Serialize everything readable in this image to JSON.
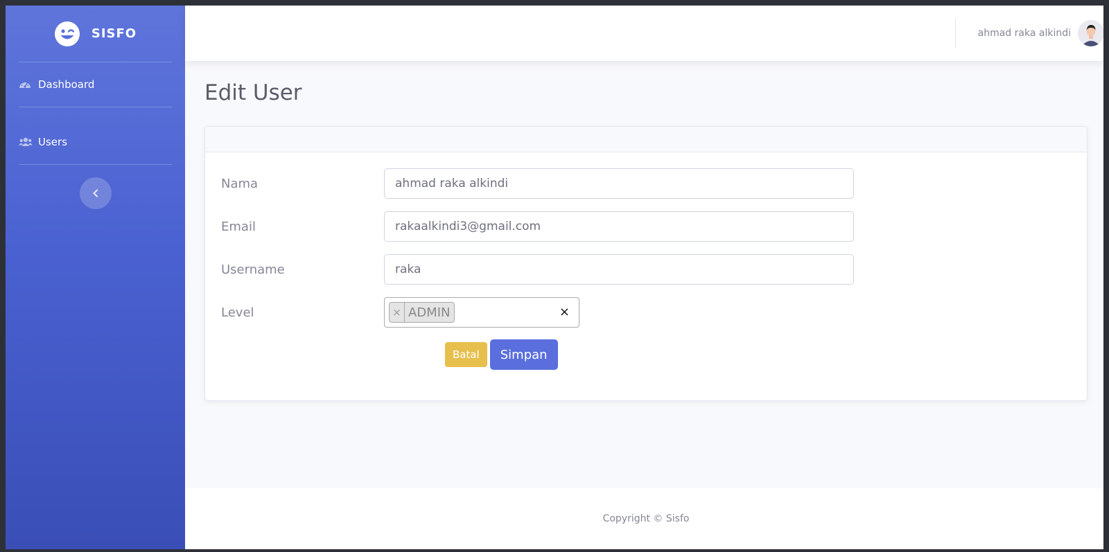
{
  "sidebar": {
    "brand": {
      "name": "SISFO",
      "icon": "laugh-wink-icon"
    },
    "items": [
      {
        "label": "Dashboard",
        "icon": "tachometer-icon"
      },
      {
        "label": "Users",
        "icon": "users-icon"
      }
    ],
    "toggle_icon": "chevron-left-icon"
  },
  "topbar": {
    "user_name": "ahmad raka alkindi",
    "avatar_icon": "user-avatar"
  },
  "page": {
    "title": "Edit User"
  },
  "form": {
    "fields": [
      {
        "label": "Nama",
        "value": "ahmad raka alkindi"
      },
      {
        "label": "Email",
        "value": "rakaalkindi3@gmail.com"
      },
      {
        "label": "Username",
        "value": "raka"
      }
    ],
    "level": {
      "label": "Level",
      "selected": [
        "ADMIN"
      ],
      "remove_glyph": "×",
      "clear_glyph": "×"
    },
    "actions": {
      "cancel_label": "Batal",
      "save_label": "Simpan"
    }
  },
  "footer": {
    "text": "Copyright © Sisfo"
  },
  "colors": {
    "primary": "#4e73df",
    "warning": "#e7bf4c",
    "text_muted": "#858796"
  }
}
